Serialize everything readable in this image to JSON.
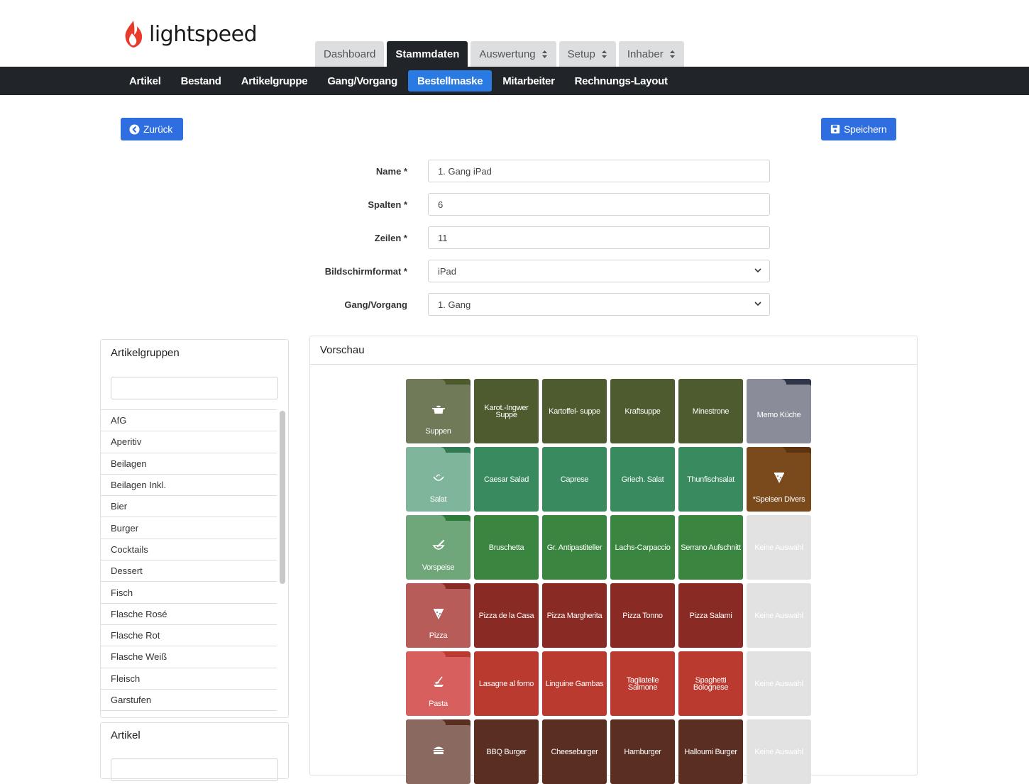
{
  "brand": {
    "name": "lightspeed",
    "accent": "#e8392b"
  },
  "top_tabs": [
    {
      "label": "Dashboard",
      "active": false,
      "has_caret": false
    },
    {
      "label": "Stammdaten",
      "active": true,
      "has_caret": false
    },
    {
      "label": "Auswertung",
      "active": false,
      "has_caret": true
    },
    {
      "label": "Setup",
      "active": false,
      "has_caret": true
    },
    {
      "label": "Inhaber",
      "active": false,
      "has_caret": true
    }
  ],
  "sub_nav": [
    {
      "label": "Artikel",
      "active": false
    },
    {
      "label": "Bestand",
      "active": false
    },
    {
      "label": "Artikelgruppe",
      "active": false
    },
    {
      "label": "Gang/Vorgang",
      "active": false
    },
    {
      "label": "Bestellmaske",
      "active": true
    },
    {
      "label": "Mitarbeiter",
      "active": false
    },
    {
      "label": "Rechnungs-Layout",
      "active": false
    }
  ],
  "buttons": {
    "back": "Zurück",
    "save": "Speichern",
    "back_icon": "chevron-left-circle-icon",
    "save_icon": "floppy-disk-icon"
  },
  "form": {
    "name_label": "Name *",
    "name_value": "1. Gang iPad",
    "columns_label": "Spalten *",
    "columns_value": "6",
    "rows_label": "Zeilen *",
    "rows_value": "11",
    "format_label": "Bildschirmformat *",
    "format_value": "iPad",
    "course_label": "Gang/Vorgang",
    "course_value": "1. Gang"
  },
  "groups_panel": {
    "title": "Artikelgruppen",
    "items": [
      "AfG",
      "Aperitiv",
      "Beilagen",
      "Beilagen Inkl.",
      "Bier",
      "Burger",
      "Cocktails",
      "Dessert",
      "Fisch",
      "Flasche Rosé",
      "Flasche Rot",
      "Flasche Weiß",
      "Fleisch",
      "Garstufen"
    ]
  },
  "articles_panel": {
    "title": "Artikel"
  },
  "preview": {
    "title": "Vorschau",
    "rows": [
      [
        {
          "type": "folder",
          "label": "Suppen",
          "icon": "pot-icon",
          "color": "#707a58",
          "tab": "#4d5a2e"
        },
        {
          "type": "item",
          "label": "Karot.-Ingwer Suppe",
          "color": "#4e5b2e"
        },
        {
          "type": "item",
          "label": "Kartoffel- suppe",
          "color": "#4e5b2e"
        },
        {
          "type": "item",
          "label": "Kraftsuppe",
          "color": "#4e5b2e"
        },
        {
          "type": "item",
          "label": "Minestrone",
          "color": "#4e5b2e"
        },
        {
          "type": "folder",
          "label": "Memo Küche",
          "icon": "",
          "color": "#8a8d99",
          "tab": "#30354a"
        }
      ],
      [
        {
          "type": "folder",
          "label": "Salat",
          "icon": "salad-bowl-icon",
          "color": "#7fb59a",
          "tab": "#2f7a52"
        },
        {
          "type": "item",
          "label": "Caesar Salad",
          "color": "#3a8a60"
        },
        {
          "type": "item",
          "label": "Caprese",
          "color": "#3a8a60"
        },
        {
          "type": "item",
          "label": "Griech. Salat",
          "color": "#3a8a60"
        },
        {
          "type": "item",
          "label": "Thunfischsalat",
          "color": "#3a8a60"
        },
        {
          "type": "folder-dark",
          "label": "*Speisen Divers",
          "icon": "pizza-slice-icon",
          "color": "#7a4a1c",
          "tab": "#5e3410"
        }
      ],
      [
        {
          "type": "folder",
          "label": "Vorspeise",
          "icon": "mortar-icon",
          "color": "#6fa77a",
          "tab": "#2e7a3a"
        },
        {
          "type": "item",
          "label": "Bruschetta",
          "color": "#3a8640"
        },
        {
          "type": "item",
          "label": "Gr. Antipastiteller",
          "color": "#3a8640"
        },
        {
          "type": "item",
          "label": "Lachs-Carpaccio",
          "color": "#3a8640"
        },
        {
          "type": "item",
          "label": "Serrano Aufschnitt",
          "color": "#3a8640"
        },
        {
          "type": "empty",
          "label": "Keine Auswahl"
        }
      ],
      [
        {
          "type": "folder",
          "label": "Pizza",
          "icon": "pizza-slice-icon",
          "color": "#b85c5a",
          "tab": "#8a2a24"
        },
        {
          "type": "item",
          "label": "Pizza de la Casa",
          "color": "#8a2a24"
        },
        {
          "type": "item",
          "label": "Pizza Margherita",
          "color": "#8a2a24"
        },
        {
          "type": "item",
          "label": "Pizza Tonno",
          "color": "#8a2a24"
        },
        {
          "type": "item",
          "label": "Pizza Salami",
          "color": "#8a2a24"
        },
        {
          "type": "empty",
          "label": "Keine Auswahl"
        }
      ],
      [
        {
          "type": "folder",
          "label": "Pasta",
          "icon": "pasta-icon",
          "color": "#d7605e",
          "tab": "#bb3a30"
        },
        {
          "type": "item",
          "label": "Lasagne al forno",
          "color": "#bb3a30"
        },
        {
          "type": "item",
          "label": "Linguine Gambas",
          "color": "#bb3a30"
        },
        {
          "type": "item",
          "label": "Tagliatelle Salmone",
          "color": "#bb3a30"
        },
        {
          "type": "item",
          "label": "Spaghetti Bolognese",
          "color": "#bb3a30"
        },
        {
          "type": "empty",
          "label": "Keine Auswahl"
        }
      ],
      [
        {
          "type": "folder",
          "label": "",
          "icon": "burger-icon",
          "color": "#8a6a60",
          "tab": "#5a2f22"
        },
        {
          "type": "item",
          "label": "BBQ Burger",
          "color": "#5a2f22"
        },
        {
          "type": "item",
          "label": "Cheeseburger",
          "color": "#5a2f22"
        },
        {
          "type": "item",
          "label": "Hamburger",
          "color": "#5a2f22"
        },
        {
          "type": "item",
          "label": "Halloumi Burger",
          "color": "#5a2f22"
        },
        {
          "type": "empty",
          "label": "Keine Auswahl"
        }
      ]
    ]
  }
}
